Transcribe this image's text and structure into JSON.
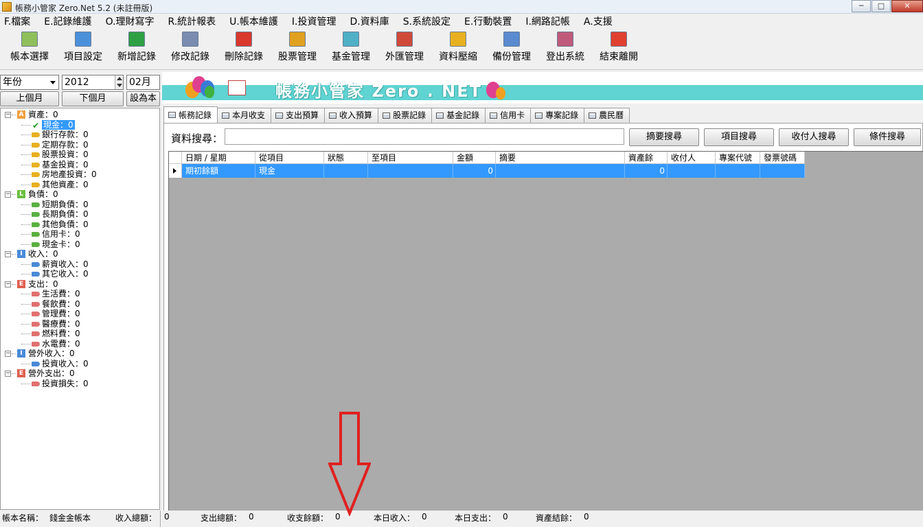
{
  "window": {
    "title": "帳務小管家 Zero.Net 5.2 (未註冊版)",
    "buttons": [
      "─",
      "□",
      "✕"
    ]
  },
  "menu": [
    "F.檔案",
    "E.記錄維護",
    "O.理財寫字",
    "R.統計報表",
    "U.帳本維護",
    "I.投資管理",
    "D.資料庫",
    "S.系統設定",
    "E.行動裝置",
    "I.網路記帳",
    "A.支援"
  ],
  "toolbar": [
    {
      "label": "帳本選擇",
      "icon": "books-icon",
      "color": "#8fbf5a"
    },
    {
      "label": "項目設定",
      "icon": "calculator-icon",
      "color": "#4a90d9"
    },
    {
      "label": "新增記錄",
      "icon": "add-record-icon",
      "color": "#2ea043"
    },
    {
      "label": "修改記錄",
      "icon": "edit-record-icon",
      "color": "#7a8cb0"
    },
    {
      "label": "刪除記錄",
      "icon": "delete-record-icon",
      "color": "#d9382c"
    },
    {
      "label": "股票管理",
      "icon": "stock-icon",
      "color": "#e0a020"
    },
    {
      "label": "基金管理",
      "icon": "fund-icon",
      "color": "#4fb0c6"
    },
    {
      "label": "外匯管理",
      "icon": "forex-icon",
      "color": "#d04a3a"
    },
    {
      "label": "資料壓縮",
      "icon": "compress-icon",
      "color": "#e8b020"
    },
    {
      "label": "備份管理",
      "icon": "backup-monitor-icon",
      "color": "#5a8ad0"
    },
    {
      "label": "登出系統",
      "icon": "logout-users-icon",
      "color": "#c05a7a"
    },
    {
      "label": "結束離開",
      "icon": "exit-icon",
      "color": "#e04030"
    }
  ],
  "period": {
    "mode": "年份",
    "year": "2012",
    "month": "02月",
    "prev_label": "上個月",
    "next_label": "下個月",
    "setting_label": "設為本"
  },
  "tree": [
    {
      "label": "資產：0",
      "type": "category",
      "badge": "A",
      "color": "#f0a040",
      "children": [
        {
          "label": "現金：0",
          "color": "#1a9a20",
          "check": true,
          "selected": true
        },
        {
          "label": "銀行存款：0",
          "color": "#e8b020"
        },
        {
          "label": "定期存款：0",
          "color": "#e8b020"
        },
        {
          "label": "股票投資：0",
          "color": "#e8b020"
        },
        {
          "label": "基金投資：0",
          "color": "#e8b020"
        },
        {
          "label": "房地產投資：0",
          "color": "#e8b020"
        },
        {
          "label": "其他資產：0",
          "color": "#e8b020"
        }
      ]
    },
    {
      "label": "負債：0",
      "type": "category",
      "badge": "L",
      "color": "#6abf40",
      "children": [
        {
          "label": "短期負債：0",
          "color": "#5ab040"
        },
        {
          "label": "長期負債：0",
          "color": "#5ab040"
        },
        {
          "label": "其他負債：0",
          "color": "#5ab040"
        },
        {
          "label": "信用卡：0",
          "color": "#5ab040"
        },
        {
          "label": "現金卡：0",
          "color": "#5ab040"
        }
      ]
    },
    {
      "label": "收入：0",
      "type": "category",
      "badge": "I",
      "color": "#4a8ad8",
      "children": [
        {
          "label": "薪資收入：0",
          "color": "#4a8ad8"
        },
        {
          "label": "其它收入：0",
          "color": "#4a8ad8"
        }
      ]
    },
    {
      "label": "支出：0",
      "type": "category",
      "badge": "E",
      "color": "#e06050",
      "children": [
        {
          "label": "生活費：0",
          "color": "#e07070"
        },
        {
          "label": "餐飲費：0",
          "color": "#e07070"
        },
        {
          "label": "管理費：0",
          "color": "#e07070"
        },
        {
          "label": "醫療費：0",
          "color": "#e07070"
        },
        {
          "label": "燃料費：0",
          "color": "#e07070"
        },
        {
          "label": "水電費：0",
          "color": "#e07070"
        }
      ]
    },
    {
      "label": "營外收入：0",
      "type": "category",
      "badge": "I",
      "color": "#4a8ad8",
      "children": [
        {
          "label": "投資收入：0",
          "color": "#4a8ad8"
        }
      ]
    },
    {
      "label": "營外支出：0",
      "type": "category",
      "badge": "E",
      "color": "#e06050",
      "children": [
        {
          "label": "投資損失：0",
          "color": "#e07070"
        }
      ]
    }
  ],
  "banner": {
    "title": "帳務小管家 Zero . NET"
  },
  "tabs": [
    "帳務記錄",
    "本月收支",
    "支出預算",
    "收入預算",
    "股票記錄",
    "基金記錄",
    "信用卡",
    "專案記錄",
    "農民曆"
  ],
  "search": {
    "label": "資料搜尋：",
    "value": "",
    "buttons": [
      "摘要搜尋",
      "項目搜尋",
      "收付人搜尋",
      "條件搜尋"
    ]
  },
  "grid": {
    "columns": [
      "日期 / 星期",
      "從項目",
      "狀態",
      "至項目",
      "金額",
      "摘要",
      "資產餘",
      "收付人",
      "專案代號",
      "發票號碼"
    ],
    "rows": [
      [
        "期初餘額",
        "現金",
        "",
        "",
        "0",
        "",
        "0",
        "",
        "",
        ""
      ]
    ]
  },
  "status": {
    "book_label": "帳本名稱：",
    "book_name": "錢金金帳本",
    "income_label": "收入總額：",
    "income_value": "0",
    "expense_label": "支出總額：",
    "expense_value": "0",
    "balance_label": "收支餘額：",
    "balance_value": "0",
    "month_income_label": "本日收入：",
    "month_income_value": "0",
    "month_expense_label": "本日支出：",
    "month_expense_value": "0",
    "asset_label": "資產結餘：",
    "asset_value": "0"
  },
  "colors": {
    "selection": "#3399ff",
    "banner_stripe": "#5fd4d2",
    "annotation_arrow": "#e02020"
  }
}
